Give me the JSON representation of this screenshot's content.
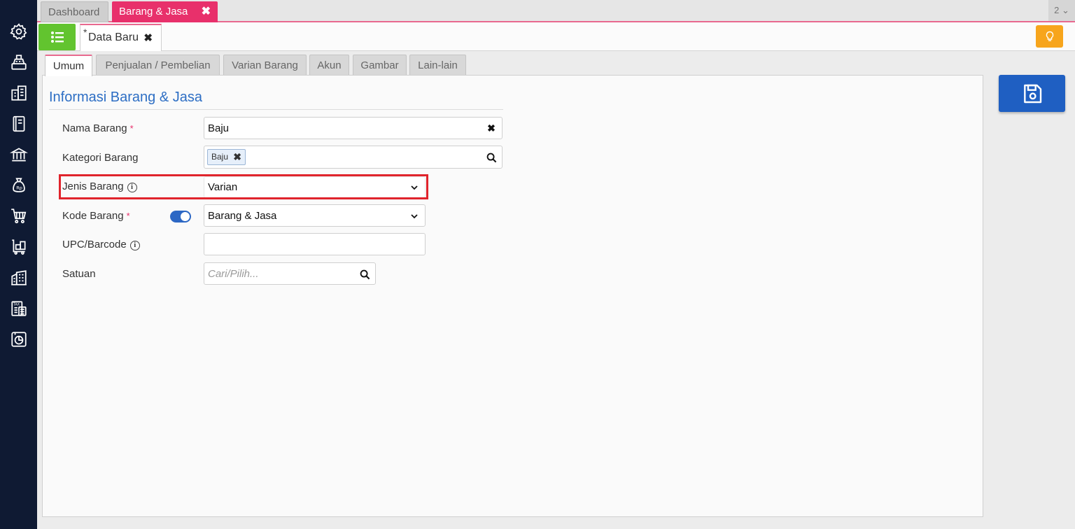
{
  "top_tabs": [
    {
      "label": "Dashboard",
      "active": false
    },
    {
      "label": "Barang & Jasa",
      "active": true,
      "close": "✖"
    }
  ],
  "page_count": "2 ⌄",
  "doc_tab": {
    "modified_marker": "*",
    "label": "Data Baru",
    "close": "✖"
  },
  "inner_tabs": [
    "Umum",
    "Penjualan / Pembelian",
    "Varian Barang",
    "Akun",
    "Gambar",
    "Lain-lain"
  ],
  "section_title": "Informasi Barang & Jasa",
  "form": {
    "nama_barang": {
      "label": "Nama Barang",
      "required": "*",
      "value": "Baju",
      "clear": "✖"
    },
    "kategori_barang": {
      "label": "Kategori Barang",
      "chip": "Baju",
      "chip_remove": "✖"
    },
    "jenis_barang": {
      "label": "Jenis Barang",
      "info": "i",
      "value": "Varian"
    },
    "kode_barang": {
      "label": "Kode Barang",
      "required": "*",
      "toggle_on": true,
      "value": "Barang & Jasa"
    },
    "upc_barcode": {
      "label": "UPC/Barcode",
      "info": "i",
      "value": ""
    },
    "satuan": {
      "label": "Satuan",
      "placeholder": "Cari/Pilih..."
    }
  },
  "colors": {
    "sidebar_bg": "#0f1a33",
    "accent_pink": "#e8306b",
    "green_button": "#62c42f",
    "save_blue": "#1f5fc2",
    "tip_orange": "#f7a51c",
    "highlight_red": "#e0242c",
    "title_blue": "#2d6ec4"
  },
  "icons": {
    "sidebar": [
      "gear-icon",
      "cash-register-icon",
      "building-icon",
      "ledger-icon",
      "bank-icon",
      "money-bag-icon",
      "shopping-cart-icon",
      "cart-boxes-icon",
      "warehouse-icon",
      "tax-document-icon",
      "report-chart-icon"
    ]
  }
}
